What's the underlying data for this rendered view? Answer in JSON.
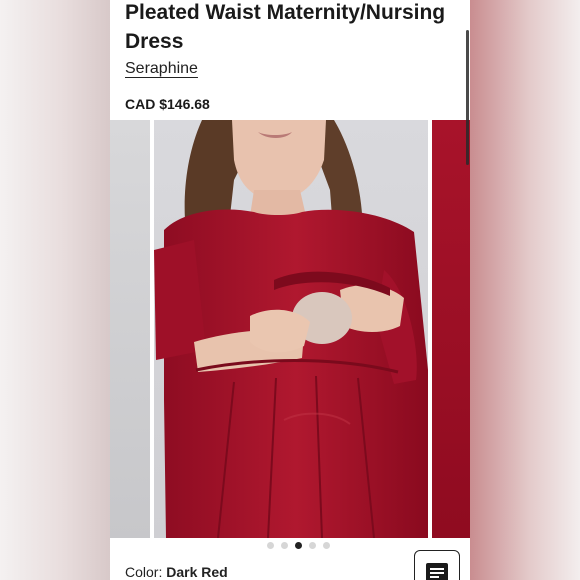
{
  "product": {
    "title": "Pleated Waist Maternity/Nursing Dress",
    "brand": "Seraphine",
    "price": "CAD $146.68"
  },
  "carousel": {
    "slide_count": 5,
    "active_index": 2,
    "image_subject": "Woman in dark red nursing dress with pleated waist"
  },
  "color_selector": {
    "label": "Color:",
    "value": "Dark Red"
  },
  "icons": {
    "list_button": "list-icon"
  },
  "colors": {
    "dress": "#a8132a",
    "text": "#1a1a1a"
  }
}
